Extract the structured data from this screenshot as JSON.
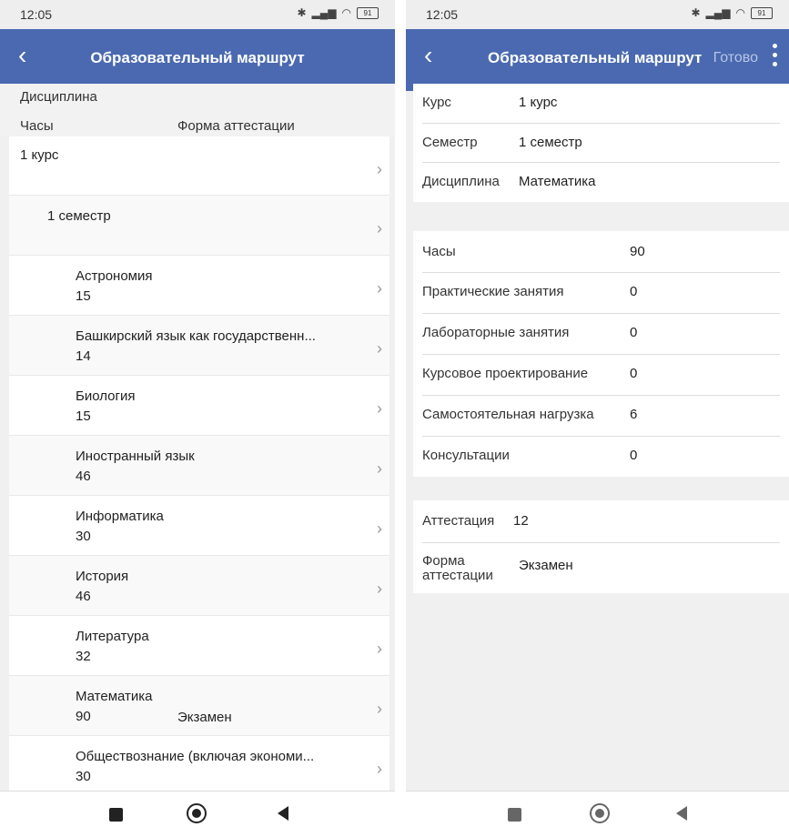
{
  "left": {
    "status": {
      "time": "12:05",
      "battery": "91"
    },
    "title": "Образовательный маршрут",
    "header": {
      "discipline": "Дисциплина",
      "hours": "Часы",
      "form": "Форма аттестации"
    },
    "course_row": {
      "label": "1 курс"
    },
    "semester_row": {
      "label": "1 семестр"
    },
    "subjects": [
      {
        "name": "Астрономия",
        "hours": "15",
        "form": ""
      },
      {
        "name": "Башкирский язык как государственн...",
        "hours": "14",
        "form": ""
      },
      {
        "name": "Биология",
        "hours": "15",
        "form": ""
      },
      {
        "name": "Иностранный язык",
        "hours": "46",
        "form": ""
      },
      {
        "name": "Информатика",
        "hours": "30",
        "form": ""
      },
      {
        "name": "История",
        "hours": "46",
        "form": ""
      },
      {
        "name": "Литература",
        "hours": "32",
        "form": ""
      },
      {
        "name": "Математика",
        "hours": "90",
        "form": "Экзамен"
      },
      {
        "name": "Обществознание (включая экономи...",
        "hours": "30",
        "form": ""
      }
    ]
  },
  "right": {
    "status": {
      "time": "12:05",
      "battery": "91"
    },
    "title": "Образовательный маршрут",
    "done_label": "Готово",
    "general": [
      {
        "label": "Курс",
        "value": "1 курс"
      },
      {
        "label": "Семестр",
        "value": "1 семестр"
      },
      {
        "label": "Дисциплина",
        "value": "Математика"
      }
    ],
    "hours": [
      {
        "label": "Часы",
        "value": "90"
      },
      {
        "label": "Практические занятия",
        "value": "0"
      },
      {
        "label": "Лабораторные занятия",
        "value": "0"
      },
      {
        "label": "Курсовое проектирование",
        "value": "0"
      },
      {
        "label": "Самостоятельная нагрузка",
        "value": "6"
      },
      {
        "label": "Консультации",
        "value": "0"
      }
    ],
    "attestation": {
      "label": "Аттестация",
      "value": "12"
    },
    "form": {
      "label_line1": "Форма",
      "label_line2": "аттестации",
      "value": "Экзамен"
    }
  },
  "icons": {
    "back": "chevron-left-icon",
    "chevron": "chevron-right-icon",
    "menu": "more-vertical-icon"
  },
  "colors": {
    "navbar": "#4a69b0",
    "done_disabled": "#b8c6e6"
  }
}
